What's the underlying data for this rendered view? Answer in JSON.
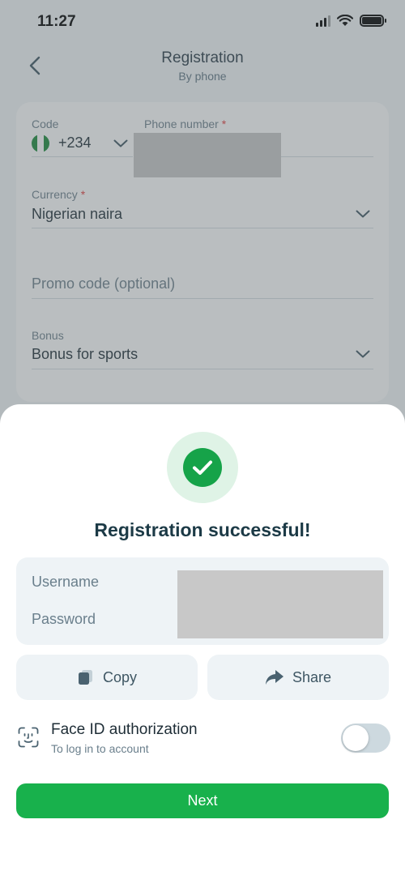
{
  "status_bar": {
    "time": "11:27"
  },
  "header": {
    "title": "Registration",
    "subtitle": "By phone"
  },
  "form": {
    "code_label": "Code",
    "code_value": "+234",
    "phone_label": "Phone number",
    "required_mark": "*",
    "currency_label": "Currency",
    "currency_value": "Nigerian naira",
    "promo_placeholder": "Promo code (optional)",
    "bonus_label": "Bonus",
    "bonus_value": "Bonus for sports"
  },
  "sheet": {
    "title": "Registration successful!",
    "username_label": "Username",
    "password_label": "Password",
    "copy_label": "Copy",
    "share_label": "Share",
    "faceid_title": "Face ID authorization",
    "faceid_subtitle": "To log in to account",
    "faceid_enabled": false,
    "next_label": "Next"
  },
  "icons": {
    "back": "chevron-left-icon",
    "dropdown": "chevron-down-icon",
    "flag": "nigeria-flag-icon",
    "success": "checkmark-icon",
    "copy": "copy-icon",
    "share": "share-arrow-icon",
    "faceid": "face-id-icon"
  },
  "colors": {
    "accent_green": "#18b14c",
    "success_green": "#16a349",
    "required_red": "#e23c3c",
    "title_dark": "#1c3a46"
  }
}
